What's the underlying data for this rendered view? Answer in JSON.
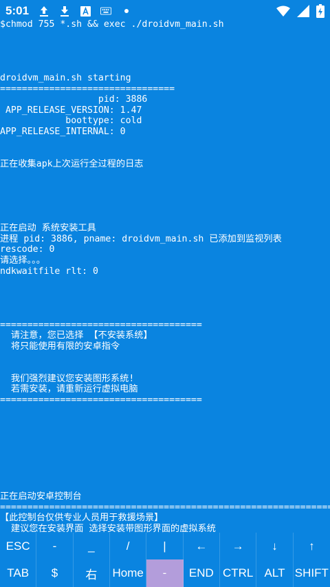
{
  "status_bar": {
    "time": "5:01",
    "icons": [
      "upload-icon",
      "download-icon",
      "font-a-icon",
      "keyboard-icon",
      "dot-icon"
    ],
    "right_icons": [
      "wifi-icon",
      "signal-icon",
      "battery-icon"
    ]
  },
  "terminal": {
    "lines": [
      "$chmod 755 *.sh && exec ./droidvm_main.sh",
      "",
      "",
      "",
      "",
      "droidvm_main.sh starting",
      "================================",
      "                  pid: 3886",
      " APP_RELEASE_VERSION: 1.47",
      "            boottype: cold",
      "APP_RELEASE_INTERNAL: 0",
      "",
      "",
      "正在收集apk上次运行全过程的日志",
      "",
      "",
      "",
      "",
      "",
      "正在启动 系统安装工具",
      "进程 pid: 3886, pname: droidvm_main.sh 已添加到监视列表",
      "rescode: 0",
      "请选择。。。",
      "ndkwaitfile rlt: 0",
      "",
      "",
      "",
      "",
      "=====================================",
      "  请注意，您已选择 【不安装系统】",
      "  将只能使用有限的安卓指令",
      "",
      "",
      "  我们强烈建议您安装图形系统!",
      "  若需安装，请重新运行虚拟电脑",
      "=====================================",
      "",
      "",
      "",
      "",
      "",
      "",
      "",
      "",
      "正在启动安卓控制台",
      "=============================================================",
      "【此控制台仅供专业人员用于救援场景】",
      "  建议您在安装界面 选择安装带图形界面的虚拟系统"
    ]
  },
  "keyboard": {
    "row1": [
      "ESC",
      "-",
      "_",
      "/",
      "|",
      "←",
      "→",
      "↓",
      "↑"
    ],
    "row2": [
      "TAB",
      "$",
      "右",
      "Home",
      "-",
      "END",
      "CTRL",
      "ALT",
      "SHIFT"
    ],
    "active_key": "row2-4",
    "active_color": "#b39ddb",
    "background_color": "#0a84e0"
  }
}
